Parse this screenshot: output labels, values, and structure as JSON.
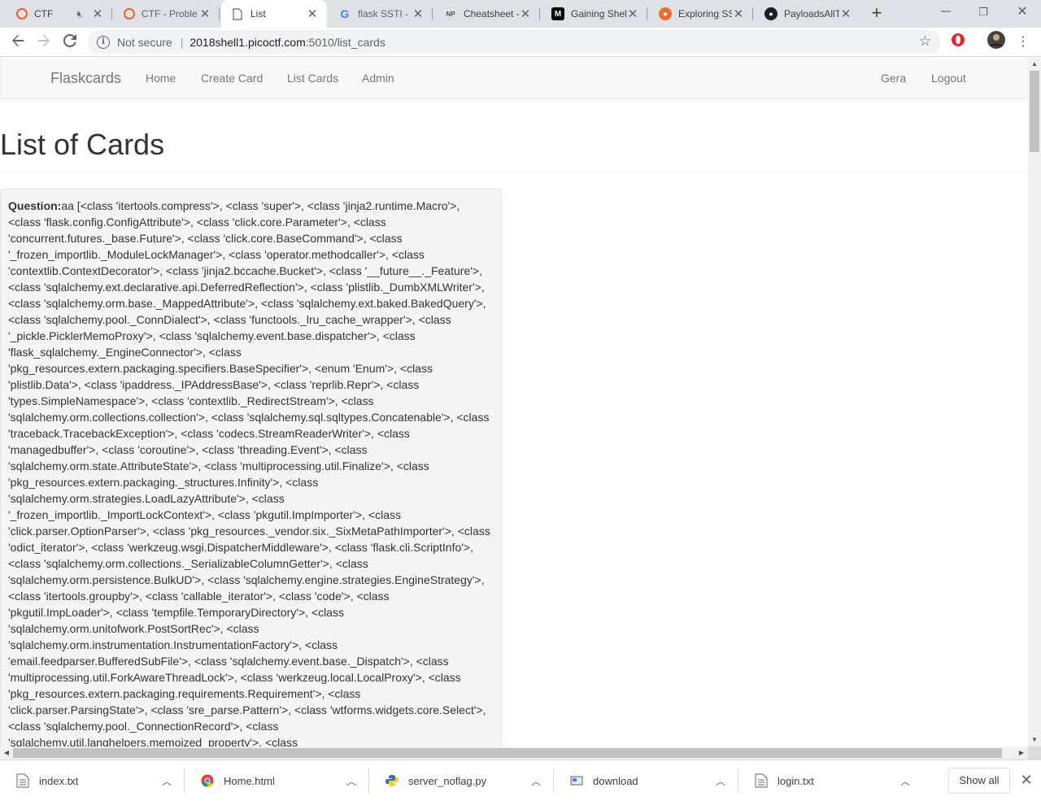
{
  "browser": {
    "tabs": [
      {
        "title": "CTF",
        "icon": "ctf-icon",
        "active": false,
        "muted": true
      },
      {
        "title": "CTF - Proble",
        "icon": "ctf-icon",
        "active": false
      },
      {
        "title": "List",
        "icon": "page-icon",
        "active": true
      },
      {
        "title": "flask SSTI - C",
        "icon": "google-icon",
        "active": false
      },
      {
        "title": "Cheatsheet -",
        "icon": "np-icon",
        "active": false
      },
      {
        "title": "Gaining Shel",
        "icon": "medium-icon",
        "active": false
      },
      {
        "title": "Exploring SS",
        "icon": "exploring-icon",
        "active": false
      },
      {
        "title": "PayloadsAllT",
        "icon": "github-icon",
        "active": false
      }
    ],
    "new_tab": "+",
    "address": {
      "security_label": "Not secure",
      "host": "2018shell1.picoctf.com",
      "path": ":5010/list_cards"
    },
    "window_controls": {
      "minimize": "─",
      "restore": "❐",
      "close": "✕"
    }
  },
  "site": {
    "brand": "Flaskcards",
    "nav": [
      "Home",
      "Create Card",
      "List Cards",
      "Admin"
    ],
    "nav_right": [
      "Gera",
      "Logout"
    ]
  },
  "page": {
    "title": "List of Cards",
    "card": {
      "label": "Question:",
      "text": "aa [<class 'itertools.compress'>, <class 'super'>, <class 'jinja2.runtime.Macro'>, <class 'flask.config.ConfigAttribute'>, <class 'click.core.Parameter'>, <class 'concurrent.futures._base.Future'>, <class 'click.core.BaseCommand'>, <class '_frozen_importlib._ModuleLockManager'>, <class 'operator.methodcaller'>, <class 'contextlib.ContextDecorator'>, <class 'jinja2.bccache.Bucket'>, <class '__future__._Feature'>, <class 'sqlalchemy.ext.declarative.api.DeferredReflection'>, <class 'plistlib._DumbXMLWriter'>, <class 'sqlalchemy.orm.base._MappedAttribute'>, <class 'sqlalchemy.ext.baked.BakedQuery'>, <class 'sqlalchemy.pool._ConnDialect'>, <class 'functools._lru_cache_wrapper'>, <class '_pickle.PicklerMemoProxy'>, <class 'sqlalchemy.event.base.dispatcher'>, <class 'flask_sqlalchemy._EngineConnector'>, <class 'pkg_resources.extern.packaging.specifiers.BaseSpecifier'>, <enum 'Enum'>, <class 'plistlib.Data'>, <class 'ipaddress._IPAddressBase'>, <class 'reprlib.Repr'>, <class 'types.SimpleNamespace'>, <class 'contextlib._RedirectStream'>, <class 'sqlalchemy.orm.collections.collection'>, <class 'sqlalchemy.sql.sqltypes.Concatenable'>, <class 'traceback.TracebackException'>, <class 'codecs.StreamReaderWriter'>, <class 'managedbuffer'>, <class 'coroutine'>, <class 'threading.Event'>, <class 'sqlalchemy.orm.state.AttributeState'>, <class 'multiprocessing.util.Finalize'>, <class 'pkg_resources.extern.packaging._structures.Infinity'>, <class 'sqlalchemy.orm.strategies.LoadLazyAttribute'>, <class '_frozen_importlib._ImportLockContext'>, <class 'pkgutil.ImpImporter'>, <class 'click.parser.OptionParser'>, <class 'pkg_resources._vendor.six._SixMetaPathImporter'>, <class 'odict_iterator'>, <class 'werkzeug.wsgi.DispatcherMiddleware'>, <class 'flask.cli.ScriptInfo'>, <class 'sqlalchemy.orm.collections._SerializableColumnGetter'>, <class 'sqlalchemy.orm.persistence.BulkUD'>, <class 'sqlalchemy.engine.strategies.EngineStrategy'>, <class 'itertools.groupby'>, <class 'callable_iterator'>, <class 'code'>, <class 'pkgutil.ImpLoader'>, <class 'tempfile.TemporaryDirectory'>, <class 'sqlalchemy.orm.unitofwork.PostSortRec'>, <class 'sqlalchemy.orm.instrumentation.InstrumentationFactory'>, <class 'email.feedparser.BufferedSubFile'>, <class 'sqlalchemy.event.base._Dispatch'>, <class 'multiprocessing.util.ForkAwareThreadLock'>, <class 'werkzeug.local.LocalProxy'>, <class 'pkg_resources.extern.packaging.requirements.Requirement'>, <class 'click.parser.ParsingState'>, <class 'sre_parse.Pattern'>, <class 'wtforms.widgets.core.Select'>, <class 'sqlalchemy.pool._ConnectionRecord'>, <class 'sqlalchemy.util.langhelpers.memoized_property'>, <class"
    }
  },
  "downloads": [
    {
      "name": "index.txt",
      "icon": "text-file-icon"
    },
    {
      "name": "Home.html",
      "icon": "chrome-file-icon"
    },
    {
      "name": "server_noflag.py",
      "icon": "python-file-icon"
    },
    {
      "name": "download",
      "icon": "generic-file-icon"
    },
    {
      "name": "login.txt",
      "icon": "text-file-icon"
    }
  ],
  "show_all_label": "Show all",
  "colors": {
    "tab_strip": "#dee1e6",
    "navbar": "#f8f8f8",
    "card_bg": "#f5f5f5",
    "link": "#777777"
  }
}
